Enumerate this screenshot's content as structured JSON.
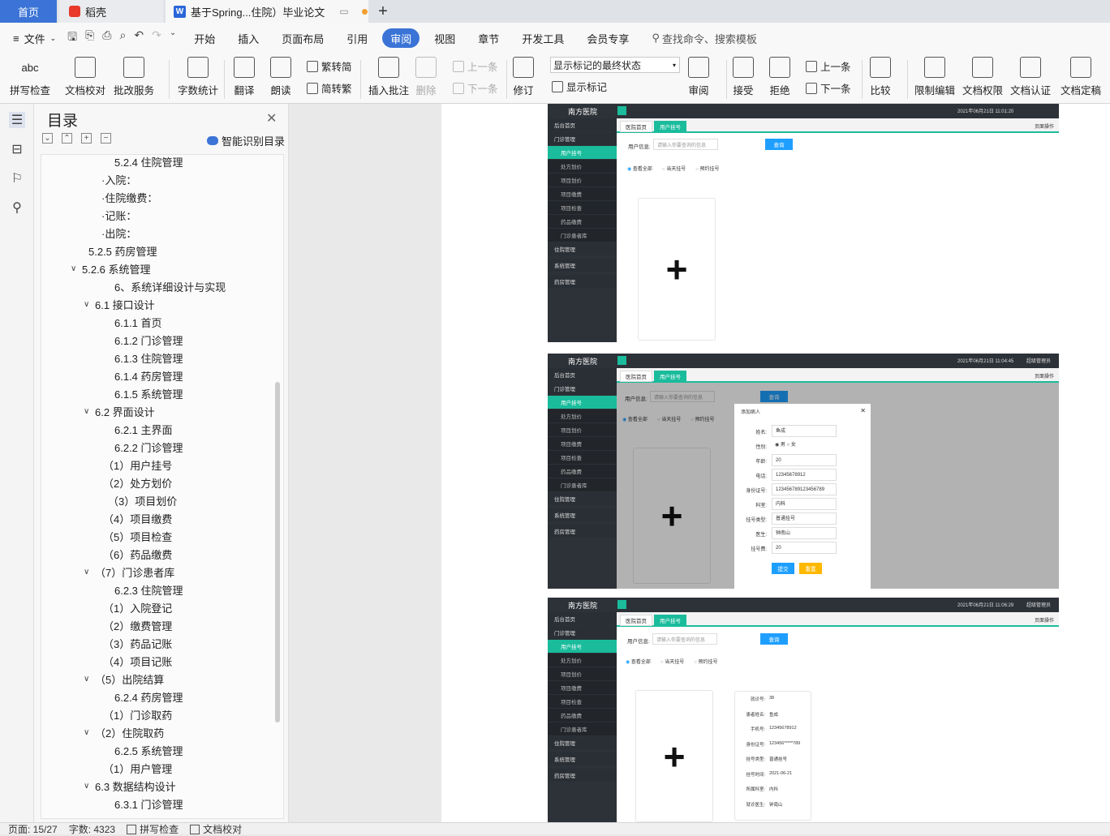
{
  "tabs": {
    "home": "首页",
    "daoke": "稻壳",
    "doc": "基于Spring...住院）毕业论文"
  },
  "menu": {
    "file": "文件",
    "items": [
      "开始",
      "插入",
      "页面布局",
      "引用",
      "审阅",
      "视图",
      "章节",
      "开发工具",
      "会员专享"
    ],
    "active": "审阅",
    "search": "查找命令、搜索模板"
  },
  "ribbon": {
    "spell": "拼写检查",
    "proof": "文档校对",
    "batch": "批改服务",
    "count": "字数统计",
    "translate": "翻译",
    "read": "朗读",
    "to_simp": "繁转简",
    "to_trad": "简转繁",
    "insert_comment": "插入批注",
    "delete": "删除",
    "prev": "上一条",
    "next": "下一条",
    "revise": "修订",
    "combo": "显示标记的最终状态",
    "show_marks": "显示标记",
    "review": "审阅",
    "accept": "接受",
    "reject": "拒绝",
    "prev2": "上一条",
    "next2": "下一条",
    "compare": "比较",
    "restrict": "限制编辑",
    "perm": "文档权限",
    "cert": "文档认证",
    "finalize": "文档定稿"
  },
  "toc": {
    "title": "目录",
    "smart": "智能识别目录",
    "items": [
      {
        "text": "5.2.4 住院管理",
        "indent": 98,
        "caret": ""
      },
      {
        "text": "·入院：",
        "indent": 82,
        "caret": ""
      },
      {
        "text": "·住院缴费：",
        "indent": 82,
        "caret": ""
      },
      {
        "text": "·记账：",
        "indent": 82,
        "caret": ""
      },
      {
        "text": "·出院：",
        "indent": 82,
        "caret": ""
      },
      {
        "text": "5.2.5 药房管理",
        "indent": 66,
        "caret": ""
      },
      {
        "text": "5.2.6 系统管理",
        "indent": 52,
        "caret": "v"
      },
      {
        "text": "6、系统详细设计与实现",
        "indent": 98,
        "caret": ""
      },
      {
        "text": "6.1 接口设计",
        "indent": 68,
        "caret": "v"
      },
      {
        "text": "6.1.1 首页",
        "indent": 98,
        "caret": ""
      },
      {
        "text": "6.1.2 门诊管理",
        "indent": 98,
        "caret": ""
      },
      {
        "text": "6.1.3 住院管理",
        "indent": 98,
        "caret": ""
      },
      {
        "text": "6.1.4 药房管理",
        "indent": 98,
        "caret": ""
      },
      {
        "text": "6.1.5 系统管理",
        "indent": 98,
        "caret": ""
      },
      {
        "text": "6.2 界面设计",
        "indent": 68,
        "caret": "v"
      },
      {
        "text": "6.2.1 主界面",
        "indent": 98,
        "caret": ""
      },
      {
        "text": "6.2.2 门诊管理",
        "indent": 98,
        "caret": ""
      },
      {
        "text": "（1）用户挂号",
        "indent": 84,
        "caret": ""
      },
      {
        "text": "（2）处方划价",
        "indent": 84,
        "caret": ""
      },
      {
        "text": "（3）项目划价",
        "indent": 90,
        "caret": ""
      },
      {
        "text": "（4）项目缴费",
        "indent": 84,
        "caret": ""
      },
      {
        "text": "（5）项目检查",
        "indent": 84,
        "caret": ""
      },
      {
        "text": "（6）药品缴费",
        "indent": 84,
        "caret": ""
      },
      {
        "text": "（7）门诊患者库",
        "indent": 68,
        "caret": "v"
      },
      {
        "text": "6.2.3 住院管理",
        "indent": 98,
        "caret": ""
      },
      {
        "text": "（1）入院登记",
        "indent": 84,
        "caret": ""
      },
      {
        "text": "（2）缴费管理",
        "indent": 84,
        "caret": ""
      },
      {
        "text": "（3）药品记账",
        "indent": 84,
        "caret": ""
      },
      {
        "text": "（4）项目记账",
        "indent": 84,
        "caret": ""
      },
      {
        "text": "（5）出院结算",
        "indent": 68,
        "caret": "v"
      },
      {
        "text": "6.2.4 药房管理",
        "indent": 98,
        "caret": ""
      },
      {
        "text": "（1）门诊取药",
        "indent": 84,
        "caret": ""
      },
      {
        "text": "（2）住院取药",
        "indent": 68,
        "caret": "v"
      },
      {
        "text": "6.2.5 系统管理",
        "indent": 98,
        "caret": ""
      },
      {
        "text": "（1）用户管理",
        "indent": 84,
        "caret": ""
      },
      {
        "text": "6.3 数据结构设计",
        "indent": 68,
        "caret": "v"
      },
      {
        "text": "6.3.1 门诊管理",
        "indent": 98,
        "caret": ""
      }
    ]
  },
  "screens": {
    "logo": "南方医院",
    "s1_date": "2021年06月21日 11:01:20",
    "s2_date": "2021年06月21日 11:04:45",
    "s3_date": "2021年06月21日 11:06:29",
    "user": "超级管理员",
    "tab_home": "医院首页",
    "tab_reg": "用户挂号",
    "page_op": "页面操作",
    "nav": [
      {
        "text": "后台首页",
        "type": "hd"
      },
      {
        "text": "门诊管理",
        "type": "hd"
      },
      {
        "text": "用户挂号",
        "type": "on"
      },
      {
        "text": "处方划价",
        "type": "sub"
      },
      {
        "text": "项目划价",
        "type": "sub"
      },
      {
        "text": "项目缴费",
        "type": "sub"
      },
      {
        "text": "项目检查",
        "type": "sub"
      },
      {
        "text": "药品缴费",
        "type": "sub"
      },
      {
        "text": "门诊患者库",
        "type": "sub"
      },
      {
        "text": "住院管理",
        "type": "hd"
      },
      {
        "text": "系统管理",
        "type": "hd"
      },
      {
        "text": "药房管理",
        "type": "hd"
      }
    ],
    "user_info_label": "用户信息:",
    "user_info_ph": "请输入你要查询的信息",
    "query_btn": "查询",
    "radios": [
      "查看全部",
      "当天挂号",
      "预约挂号"
    ],
    "modal": {
      "title": "添加病人",
      "rows": [
        {
          "k": "姓名:",
          "v": "鱼成"
        },
        {
          "k": "性别:",
          "v": "◉ 男   ○ 女"
        },
        {
          "k": "年龄:",
          "v": "20"
        },
        {
          "k": "电话:",
          "v": "12345678912"
        },
        {
          "k": "身份证号:",
          "v": "123456789123456789"
        },
        {
          "k": "科室:",
          "v": "内科"
        },
        {
          "k": "挂号类型:",
          "v": "普通挂号"
        },
        {
          "k": "医生:",
          "v": "钟南山"
        },
        {
          "k": "挂号费:",
          "v": "20"
        }
      ],
      "submit": "提交",
      "reset": "重置"
    },
    "info": [
      {
        "k": "就诊号:",
        "v": "38"
      },
      {
        "k": "患者姓名:",
        "v": "鱼成"
      },
      {
        "k": "手机号:",
        "v": "12345678912"
      },
      {
        "k": "身份证号:",
        "v": "123456*****789"
      },
      {
        "k": "挂号类型:",
        "v": "普通挂号"
      },
      {
        "k": "挂号时间:",
        "v": "2021-06-21"
      },
      {
        "k": "所属科室:",
        "v": "内科"
      },
      {
        "k": "就诊医生:",
        "v": "钟南山"
      }
    ]
  },
  "status": {
    "page": "页面: 15/27",
    "words": "字数: 4323",
    "spell": "拼写检查",
    "proof": "文档校对"
  }
}
